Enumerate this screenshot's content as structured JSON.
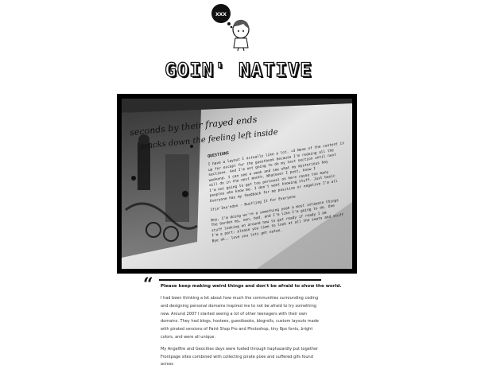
{
  "site": {
    "logo_text": "XXX",
    "title": "GOIN' NATIVE"
  },
  "hero": {
    "image_alt": "Photo of a computer screen showing a personal webpage with handwritten header and text",
    "screen_script": "seconds by their frayed ends",
    "screen_script2": "tracks down the feeling left inside",
    "screen_heading": "QUESTIONS",
    "screen_lines": [
      "I have a layout I actually like a lot. <3 None of the content is",
      "up for except for the guestbook because I'm redoing all the",
      "sections. And I'm not going to do my text section until next",
      "weekend. I can see a week and see what my mysterious bay",
      "will do in the next month. Whatever I post, know I",
      "I'm not going to get too personal on here cause too many",
      "peoples who know me. I don't want knowing stuff. Just basic",
      "Everyone has my feedback for me positive or negative I'm all"
    ],
    "screen_caption": "Ifin'Ina'ndon   -   Bustling It For Everyone",
    "screen_footer_lines": [
      "Boy, I'm doing we're a something   yeah a most intimate things",
      "The Garden my, own, bad. and I'm like I'm going to do. One",
      "stuff looking on around how to get ready if ready I am",
      "I'm a part: please you time to look at all the seats and stuff",
      "Bye ok.. love you lots get eaten."
    ]
  },
  "post": {
    "quote_glyph": "“",
    "headline": "Please keep making weird things and don't be afraid to show the world.",
    "paragraphs": [
      "I had been thinking a lot about how much the communities surrounding coding and designing personal domains inspired me to not be afraid to try something new. Around 2007 I started seeing a lot of other teenagers with their own domains. They had blogs, hostees, guestbooks, blogrolls, custom layouts made with pirated versions of Paint Shop Pro and Photoshop, tiny 8px fonts, bright colors, and were all unique.",
      "My Angelfire and Geocities days were fueled through haphazardly put together Frontpage sites combined with collecting pirate pixie and suffered gifs found across"
    ]
  },
  "colors": {
    "background": "#ffffff",
    "frame": "#000000",
    "text": "#222222"
  }
}
